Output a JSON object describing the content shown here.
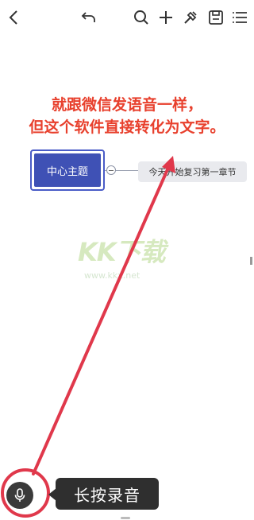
{
  "toolbar": {
    "icons": [
      "back-icon",
      "undo-icon",
      "search-icon",
      "add-icon",
      "format-icon",
      "save-icon",
      "outline-icon"
    ]
  },
  "annotation": {
    "line1": "就跟微信发语音一样，",
    "line2": "但这个软件直接转化为文字。",
    "color": "#e8402d"
  },
  "mindmap": {
    "central_topic": "中心主题",
    "child_topic": "今天开始复习第一章节",
    "accent": "#3f51b5"
  },
  "watermark": {
    "logo": "KK下载",
    "url": "www.kkx.net"
  },
  "voice": {
    "tooltip": "长按录音",
    "mic_icon": "microphone-icon",
    "highlight_color": "#e0384b"
  }
}
